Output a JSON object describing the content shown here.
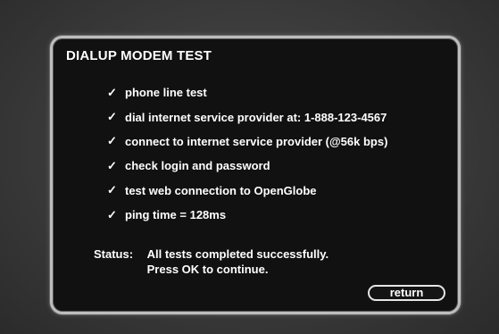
{
  "dialog": {
    "title": "DIALUP MODEM TEST",
    "check_glyph": "✓",
    "tests": [
      {
        "label": "phone line test"
      },
      {
        "label": "dial internet service provider at: 1-888-123-4567"
      },
      {
        "label": "connect to internet service provider (@56k bps)"
      },
      {
        "label": "check login and password"
      },
      {
        "label": "test web connection to OpenGlobe"
      },
      {
        "label": "ping time = 128ms"
      }
    ],
    "status_label": "Status:",
    "status_line1": "All tests completed successfully.",
    "status_line2": "Press OK to continue.",
    "return_label": "return"
  },
  "colors": {
    "panel_background": "#111111",
    "panel_border": "#bdbdbd",
    "outer_background": "#3a3a3a",
    "text": "#ffffff"
  },
  "icons": {
    "check": "check-icon"
  }
}
